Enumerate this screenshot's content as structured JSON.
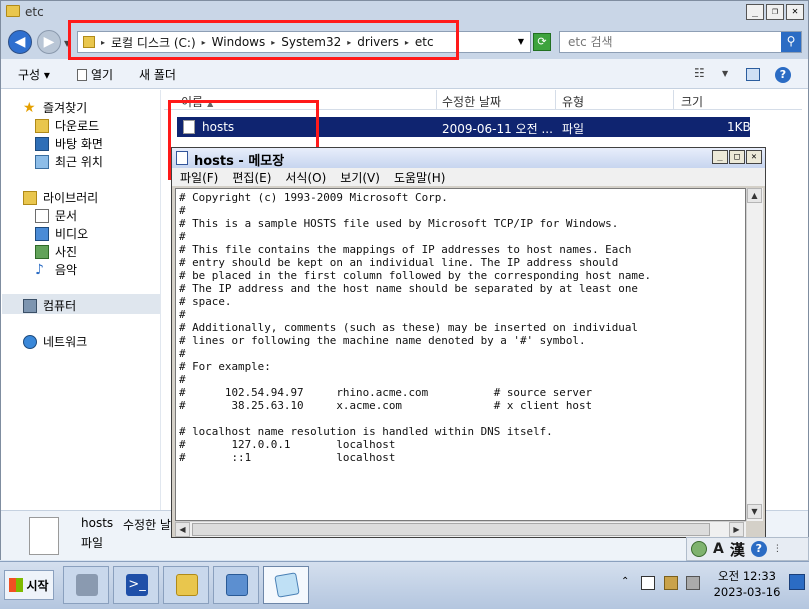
{
  "explorer": {
    "title": "etc",
    "address": {
      "crumbs": [
        "로컬 디스크 (C:)",
        "Windows",
        "System32",
        "drivers",
        "etc"
      ]
    },
    "search_placeholder": "etc 검색",
    "toolbar": {
      "organize": "구성 ▾",
      "open": "열기",
      "new_folder": "새 폴더"
    },
    "sidebar": {
      "favorites": "즐겨찾기",
      "downloads": "다운로드",
      "desktop": "바탕 화면",
      "recent": "최근 위치",
      "libraries": "라이브러리",
      "documents": "문서",
      "videos": "비디오",
      "pictures": "사진",
      "music": "음악",
      "computer": "컴퓨터",
      "network": "네트워크"
    },
    "columns": {
      "name": "이름",
      "modified": "수정한 날짜",
      "type": "유형",
      "size": "크기"
    },
    "rows": [
      {
        "name": "hosts",
        "modified": "2009-06-11 오전 ...",
        "type": "파일",
        "size": "1KB"
      }
    ],
    "details": {
      "filename": "hosts",
      "modified_label": "수정한 날",
      "type": "파일"
    }
  },
  "notepad": {
    "title": "hosts - 메모장",
    "menu": [
      "파일(F)",
      "편집(E)",
      "서식(O)",
      "보기(V)",
      "도움말(H)"
    ],
    "content": "# Copyright (c) 1993-2009 Microsoft Corp.\n#\n# This is a sample HOSTS file used by Microsoft TCP/IP for Windows.\n#\n# This file contains the mappings of IP addresses to host names. Each\n# entry should be kept on an individual line. The IP address should\n# be placed in the first column followed by the corresponding host name.\n# The IP address and the host name should be separated by at least one\n# space.\n#\n# Additionally, comments (such as these) may be inserted on individual\n# lines or following the machine name denoted by a '#' symbol.\n#\n# For example:\n#\n#      102.54.94.97     rhino.acme.com          # source server\n#       38.25.63.10     x.acme.com              # x client host\n\n# localhost name resolution is handled within DNS itself.\n#\t127.0.0.1       localhost\n#\t::1             localhost"
  },
  "langbar": {
    "letter": "A",
    "hanja": "漢",
    "help": "?"
  },
  "taskbar": {
    "start": "시작",
    "powershell_glyph": ">_",
    "clock_time": "오전 12:33",
    "clock_date": "2023-03-16"
  },
  "colors": {
    "selection": "#0f2470",
    "annotation": "#ff1a1a",
    "accent": "#2b6cc4"
  }
}
